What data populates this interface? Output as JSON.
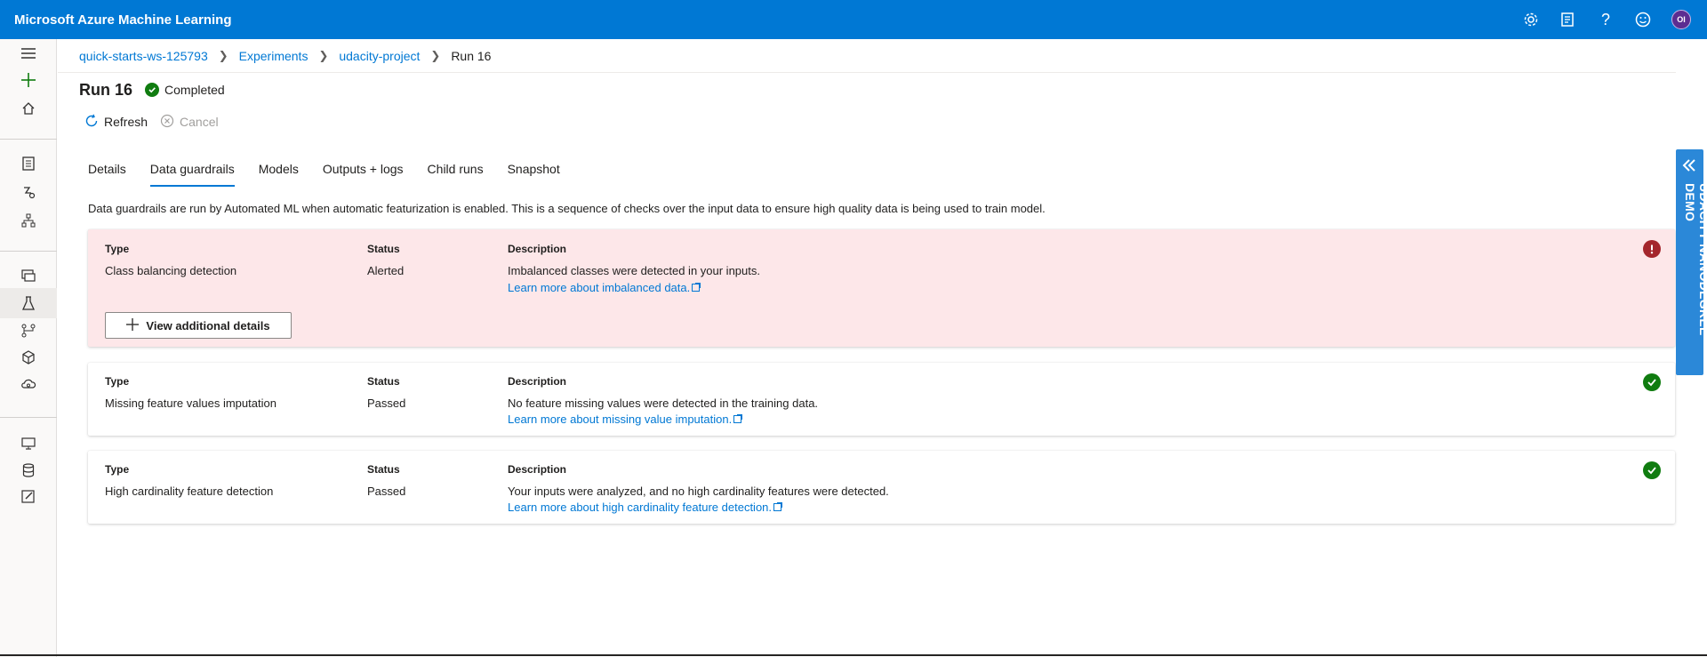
{
  "app": {
    "title": "Microsoft Azure Machine Learning",
    "user_initials": "OI"
  },
  "header_icons": [
    "settings-icon",
    "feedback-icon",
    "help-icon",
    "smiley-icon"
  ],
  "breadcrumb": [
    "quick-starts-ws-125793",
    "Experiments",
    "udacity-project",
    "Run 16"
  ],
  "run": {
    "title": "Run 16",
    "status": "Completed"
  },
  "actions": {
    "refresh": "Refresh",
    "cancel": "Cancel"
  },
  "tabs": [
    "Details",
    "Data guardrails",
    "Models",
    "Outputs + logs",
    "Child runs",
    "Snapshot"
  ],
  "active_tab": "Data guardrails",
  "intro": "Data guardrails are run by Automated ML when automatic featurization is enabled. This is a sequence of checks over the input data to ensure high quality data is being used to train model.",
  "columns": {
    "type": "Type",
    "status": "Status",
    "description": "Description"
  },
  "guardrails": [
    {
      "type": "Class balancing detection",
      "status": "Alerted",
      "description": "Imbalanced classes were detected in your inputs.",
      "link": "Learn more about imbalanced data.",
      "button": "View additional details"
    },
    {
      "type": "Missing feature values imputation",
      "status": "Passed",
      "description": "No feature missing values were detected in the training data.",
      "link": "Learn more about missing value imputation."
    },
    {
      "type": "High cardinality feature detection",
      "status": "Passed",
      "description": "Your inputs were analyzed, and no high cardinality features were detected.",
      "link": "Learn more about high cardinality feature detection."
    }
  ],
  "side_tab": "UDACITY NANODEGREE DEMO",
  "colors": {
    "brand": "#0078d4",
    "alert_bg": "#fde7e9",
    "alert_icon": "#a4262c",
    "success": "#107c10"
  }
}
